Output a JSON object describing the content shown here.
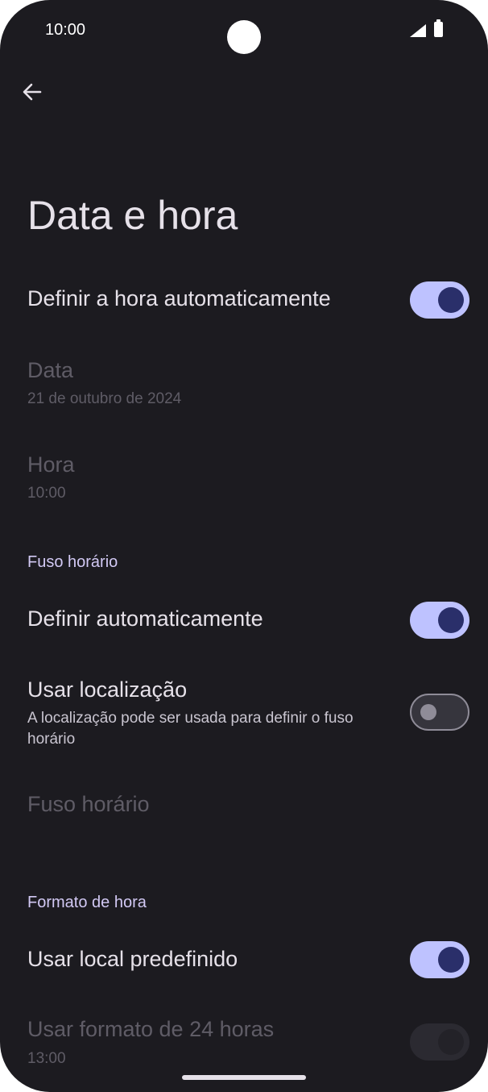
{
  "status_bar": {
    "time": "10:00",
    "icons": [
      "signal-icon",
      "battery-icon"
    ]
  },
  "toolbar": {
    "back_icon": "arrow-back-icon"
  },
  "page": {
    "title": "Data e hora"
  },
  "auto_time": {
    "label": "Definir a hora automaticamente",
    "enabled": true
  },
  "date": {
    "label": "Data",
    "value": "21 de outubro de 2024"
  },
  "time": {
    "label": "Hora",
    "value": "10:00"
  },
  "timezone_section": {
    "header": "Fuso horário"
  },
  "auto_timezone": {
    "label": "Definir automaticamente",
    "enabled": true
  },
  "use_location": {
    "label": "Usar localização",
    "summary": "A localização pode ser usada para definir o fuso horário",
    "enabled": false
  },
  "timezone": {
    "label": "Fuso horário"
  },
  "format_section": {
    "header": "Formato de hora"
  },
  "locale_default": {
    "label": "Usar local predefinido",
    "enabled": true
  },
  "format_24h": {
    "label": "Usar formato de 24 horas",
    "example": "13:00",
    "enabled": true
  },
  "colors": {
    "background": "#1c1b20",
    "accent": "#bec2ff",
    "section_header": "#d2c9f4"
  }
}
